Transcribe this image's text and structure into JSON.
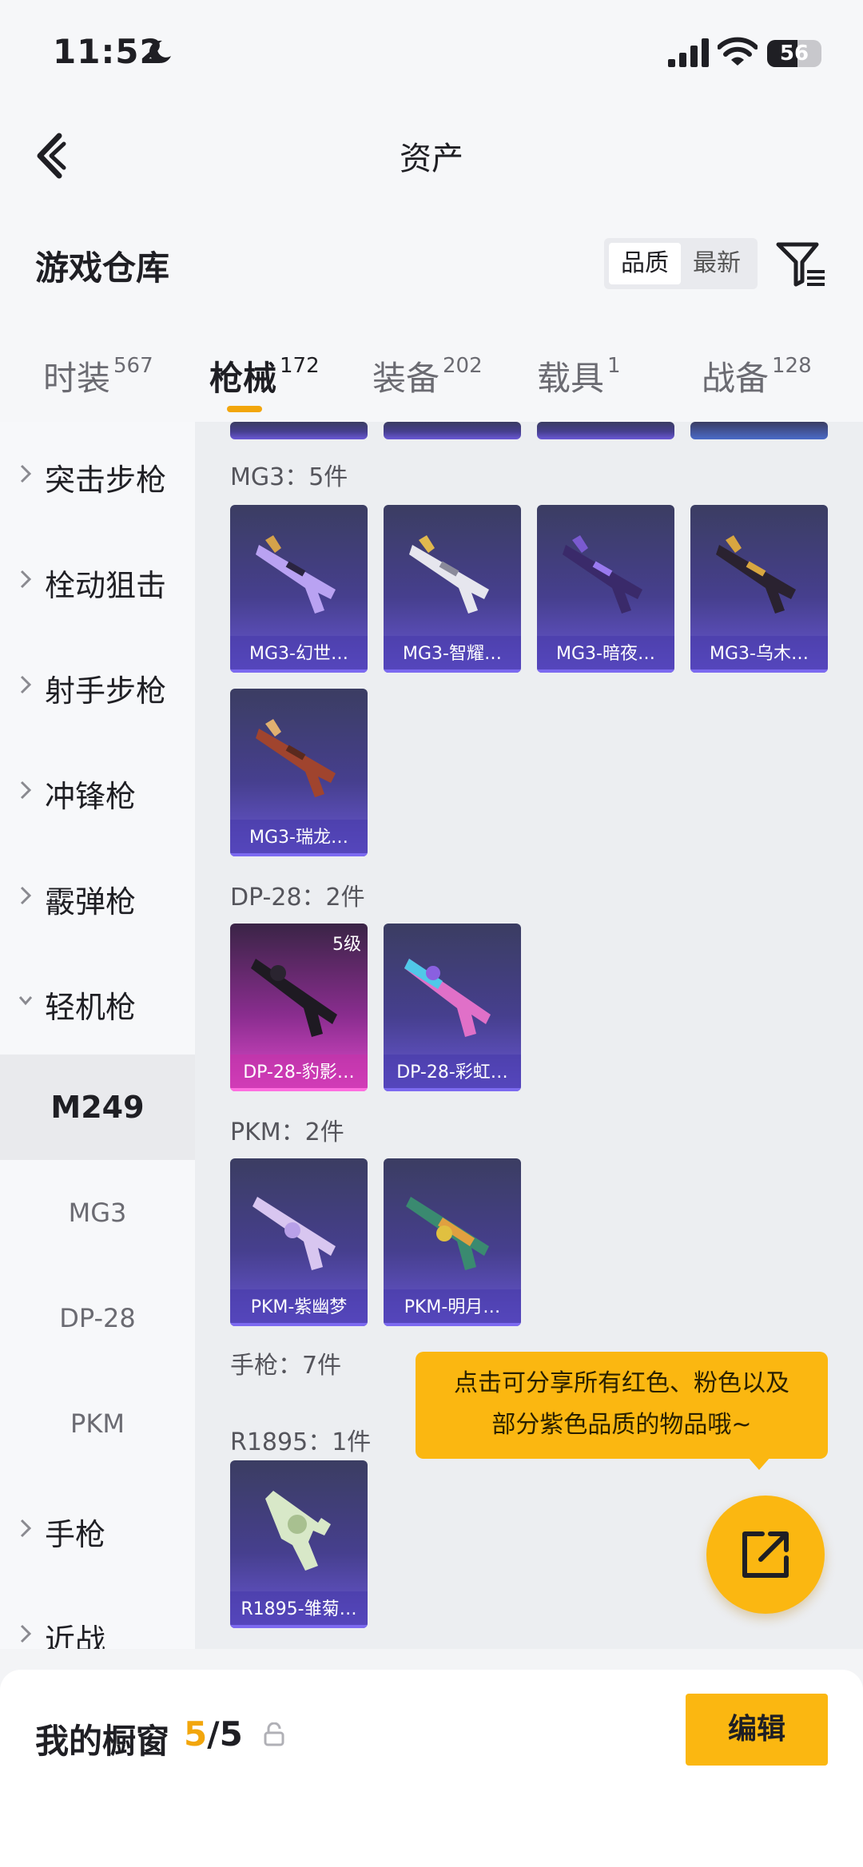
{
  "status_bar": {
    "time": "11:52",
    "battery": "56",
    "battery_level": 56
  },
  "header": {
    "title": "资产"
  },
  "warehouse": {
    "title": "游戏仓库",
    "sort_options": [
      "品质",
      "最新"
    ],
    "active_sort": "品质"
  },
  "tabs": [
    {
      "label": "时装",
      "count": "567"
    },
    {
      "label": "枪械",
      "count": "172",
      "active": true
    },
    {
      "label": "装备",
      "count": "202"
    },
    {
      "label": "载具",
      "count": "1"
    },
    {
      "label": "战备",
      "count": "128"
    }
  ],
  "sidebar": {
    "items": [
      {
        "label": "突击步枪"
      },
      {
        "label": "栓动狙击"
      },
      {
        "label": "射手步枪"
      },
      {
        "label": "冲锋枪"
      },
      {
        "label": "霰弹枪"
      },
      {
        "label": "轻机枪",
        "expanded": true
      },
      {
        "label": "手枪"
      },
      {
        "label": "近战"
      }
    ],
    "sub_items": [
      {
        "label": "M249",
        "active": true
      },
      {
        "label": "MG3"
      },
      {
        "label": "DP-28"
      },
      {
        "label": "PKM"
      }
    ]
  },
  "groups": [
    {
      "title": "MG3：5件",
      "items": [
        {
          "name": "MG3-幻世…",
          "color": "purple"
        },
        {
          "name": "MG3-智耀…",
          "color": "purple"
        },
        {
          "name": "MG3-暗夜…",
          "color": "purple"
        },
        {
          "name": "MG3-乌木…",
          "color": "purple"
        },
        {
          "name": "MG3-瑞龙…",
          "color": "purple"
        }
      ]
    },
    {
      "title": "DP-28：2件",
      "items": [
        {
          "name": "DP-28-豹影…",
          "color": "pink",
          "level": "5级"
        },
        {
          "name": "DP-28-彩虹…",
          "color": "purple"
        }
      ]
    },
    {
      "title": "PKM：2件",
      "items": [
        {
          "name": "PKM-紫幽梦",
          "color": "purple"
        },
        {
          "name": "PKM-明月…",
          "color": "purple"
        }
      ]
    },
    {
      "title": "手枪：7件",
      "items": []
    },
    {
      "title": "R1895：1件",
      "items": [
        {
          "name": "R1895-雏菊…",
          "color": "purple"
        }
      ]
    }
  ],
  "tooltip": {
    "line1": "点击可分享所有红色、粉色以及",
    "line2": "部分紫色品质的物品哦~"
  },
  "bottom_bar": {
    "label": "我的橱窗",
    "current": "5",
    "total": "/5",
    "edit_label": "编辑"
  },
  "colors": {
    "accent": "#fbb711",
    "accent_text": "#f2a60c",
    "card_purple": "#463f8e",
    "card_pink": "#e04acb"
  }
}
